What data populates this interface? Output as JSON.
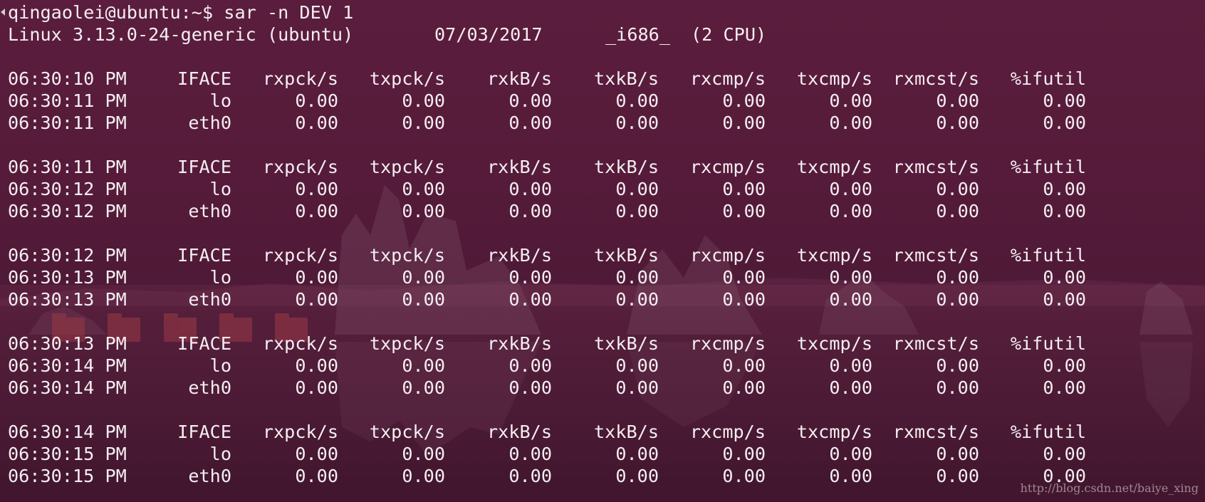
{
  "terminal": {
    "prompt": "qingaolei@ubuntu:~$ sar -n DEV 1",
    "sysinfo": {
      "kernel": "Linux 3.13.0-24-generic (ubuntu)",
      "date": "07/03/2017",
      "arch": "_i686_",
      "cpus": "(2 CPU)"
    },
    "columns": [
      "IFACE",
      "rxpck/s",
      "txpck/s",
      "rxkB/s",
      "txkB/s",
      "rxcmp/s",
      "txcmp/s",
      "rxmcst/s",
      "%ifutil"
    ],
    "blocks": [
      {
        "header_time": "06:30:10 PM",
        "rows": [
          {
            "time": "06:30:11 PM",
            "iface": "lo",
            "values": [
              "0.00",
              "0.00",
              "0.00",
              "0.00",
              "0.00",
              "0.00",
              "0.00",
              "0.00"
            ]
          },
          {
            "time": "06:30:11 PM",
            "iface": "eth0",
            "values": [
              "0.00",
              "0.00",
              "0.00",
              "0.00",
              "0.00",
              "0.00",
              "0.00",
              "0.00"
            ]
          }
        ]
      },
      {
        "header_time": "06:30:11 PM",
        "rows": [
          {
            "time": "06:30:12 PM",
            "iface": "lo",
            "values": [
              "0.00",
              "0.00",
              "0.00",
              "0.00",
              "0.00",
              "0.00",
              "0.00",
              "0.00"
            ]
          },
          {
            "time": "06:30:12 PM",
            "iface": "eth0",
            "values": [
              "0.00",
              "0.00",
              "0.00",
              "0.00",
              "0.00",
              "0.00",
              "0.00",
              "0.00"
            ]
          }
        ]
      },
      {
        "header_time": "06:30:12 PM",
        "rows": [
          {
            "time": "06:30:13 PM",
            "iface": "lo",
            "values": [
              "0.00",
              "0.00",
              "0.00",
              "0.00",
              "0.00",
              "0.00",
              "0.00",
              "0.00"
            ]
          },
          {
            "time": "06:30:13 PM",
            "iface": "eth0",
            "values": [
              "0.00",
              "0.00",
              "0.00",
              "0.00",
              "0.00",
              "0.00",
              "0.00",
              "0.00"
            ]
          }
        ]
      },
      {
        "header_time": "06:30:13 PM",
        "rows": [
          {
            "time": "06:30:14 PM",
            "iface": "lo",
            "values": [
              "0.00",
              "0.00",
              "0.00",
              "0.00",
              "0.00",
              "0.00",
              "0.00",
              "0.00"
            ]
          },
          {
            "time": "06:30:14 PM",
            "iface": "eth0",
            "values": [
              "0.00",
              "0.00",
              "0.00",
              "0.00",
              "0.00",
              "0.00",
              "0.00",
              "0.00"
            ]
          }
        ]
      },
      {
        "header_time": "06:30:14 PM",
        "rows": [
          {
            "time": "06:30:15 PM",
            "iface": "lo",
            "values": [
              "0.00",
              "0.00",
              "0.00",
              "0.00",
              "0.00",
              "0.00",
              "0.00",
              "0.00"
            ]
          },
          {
            "time": "06:30:15 PM",
            "iface": "eth0",
            "values": [
              "0.00",
              "0.00",
              "0.00",
              "0.00",
              "0.00",
              "0.00",
              "0.00",
              "0.00"
            ]
          }
        ]
      }
    ]
  },
  "watermark": "http://blog.csdn.net/baiye_xing",
  "theme": {
    "background": "#4a1a33",
    "text": "#f4eef1"
  }
}
